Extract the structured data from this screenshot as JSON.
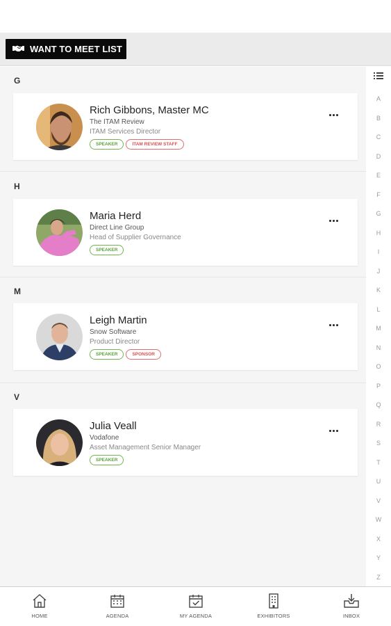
{
  "toolbar": {
    "want_to_meet_label": "WANT TO MEET LIST"
  },
  "index": {
    "letters": [
      "A",
      "B",
      "C",
      "D",
      "E",
      "F",
      "G",
      "H",
      "I",
      "J",
      "K",
      "L",
      "M",
      "N",
      "O",
      "P",
      "Q",
      "R",
      "S",
      "T",
      "U",
      "V",
      "W",
      "X",
      "Y",
      "Z"
    ]
  },
  "sections": [
    {
      "letter": "G",
      "person": {
        "name": "Rich Gibbons, Master MC",
        "company": "The ITAM Review",
        "title": "ITAM Services Director",
        "tags": [
          "SPEAKER",
          "ITAM REVIEW STAFF"
        ]
      }
    },
    {
      "letter": "H",
      "person": {
        "name": "Maria Herd",
        "company": "Direct Line Group",
        "title": "Head of Supplier Governance",
        "tags": [
          "SPEAKER"
        ]
      }
    },
    {
      "letter": "M",
      "person": {
        "name": "Leigh Martin",
        "company": "Snow Software",
        "title": "Product Director",
        "tags": [
          "SPEAKER",
          "SPONSOR"
        ]
      }
    },
    {
      "letter": "V",
      "person": {
        "name": "Julia Veall",
        "company": "Vodafone",
        "title": "Asset Management Senior Manager",
        "tags": [
          "SPEAKER"
        ]
      }
    }
  ],
  "nav": {
    "home": "HOME",
    "agenda": "AGENDA",
    "my_agenda": "MY AGENDA",
    "exhibitors": "EXHIBITORS",
    "inbox": "INBOX"
  },
  "colors": {
    "tag_green": "#5aa33a",
    "tag_red": "#d85050",
    "button_bg": "#0a0a0a"
  },
  "icons": [
    "handshake-icon",
    "list-icon",
    "more-icon",
    "home-icon",
    "calendar-icon",
    "calendar-check-icon",
    "building-icon",
    "inbox-icon"
  ]
}
